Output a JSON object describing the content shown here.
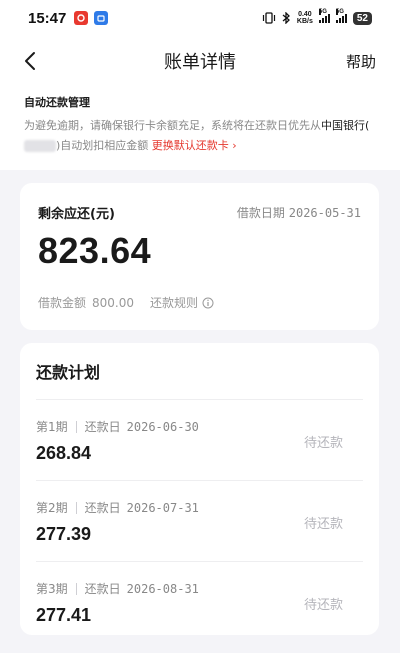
{
  "status_bar": {
    "time": "15:47",
    "net_speed_value": "0.40",
    "net_speed_unit": "KB/s",
    "signal1_label": "5G",
    "signal2_label": "5G",
    "battery": "52"
  },
  "nav": {
    "title": "账单详情",
    "help": "帮助"
  },
  "notice": {
    "title": "自动还款管理",
    "body_prefix": "为避免逾期，请确保银行卡余额充足，系统将在还款日优先从",
    "bank": "中国银行(",
    "bank_close": ")",
    "body_suffix": "自动划扣相应金额",
    "link": "更换默认还款卡",
    "link_arrow": "›"
  },
  "amount_card": {
    "remaining_label": "剩余应还(元)",
    "loan_date_label": "借款日期",
    "loan_date": "2026-05-31",
    "remaining_amount": "823.64",
    "loan_amount_label": "借款金额",
    "loan_amount": "800.00",
    "repay_rule_label": "还款规则"
  },
  "plan": {
    "title": "还款计划",
    "items": [
      {
        "period": "第1期",
        "date_label": "还款日",
        "date": "2026-06-30",
        "amount": "268.84",
        "status": "待还款"
      },
      {
        "period": "第2期",
        "date_label": "还款日",
        "date": "2026-07-31",
        "amount": "277.39",
        "status": "待还款"
      },
      {
        "period": "第3期",
        "date_label": "还款日",
        "date": "2026-08-31",
        "amount": "277.41",
        "status": "待还款"
      }
    ]
  },
  "colors": {
    "accent_red": "#e5372d",
    "page_bg": "#f4f4f8",
    "muted_text": "#888888",
    "pending_status": "#b5b5bb"
  },
  "icons": {
    "back": "chevron-left-icon",
    "info": "info-circle-icon",
    "app1": "netease-icon",
    "app2": "app-store-icon"
  }
}
